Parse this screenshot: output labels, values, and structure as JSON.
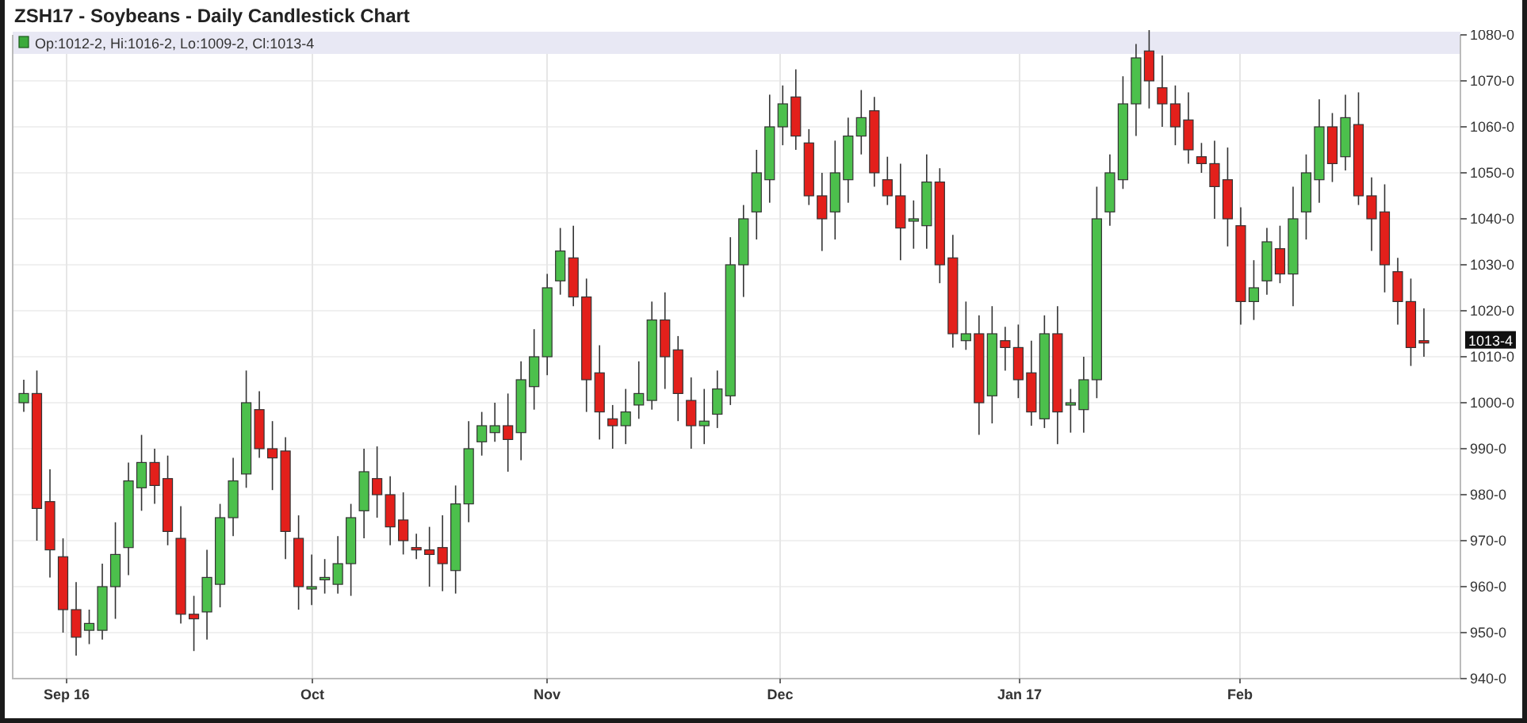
{
  "title": "ZSH17 - Soybeans - Daily Candlestick Chart",
  "legend": {
    "text": "Op:1012-2, Hi:1016-2, Lo:1009-2, Cl:1013-4"
  },
  "y_axis_labels": [
    "1080-0",
    "1070-0",
    "1060-0",
    "1050-0",
    "1040-0",
    "1030-0",
    "1020-0",
    "1010-0",
    "1000-0",
    "990-0",
    "980-0",
    "970-0",
    "960-0",
    "950-0",
    "940-0"
  ],
  "x_axis_labels": [
    "Sep 16",
    "Oct",
    "Nov",
    "Dec",
    "Jan 17",
    "Feb"
  ],
  "last_price_tag": "1013-4"
}
